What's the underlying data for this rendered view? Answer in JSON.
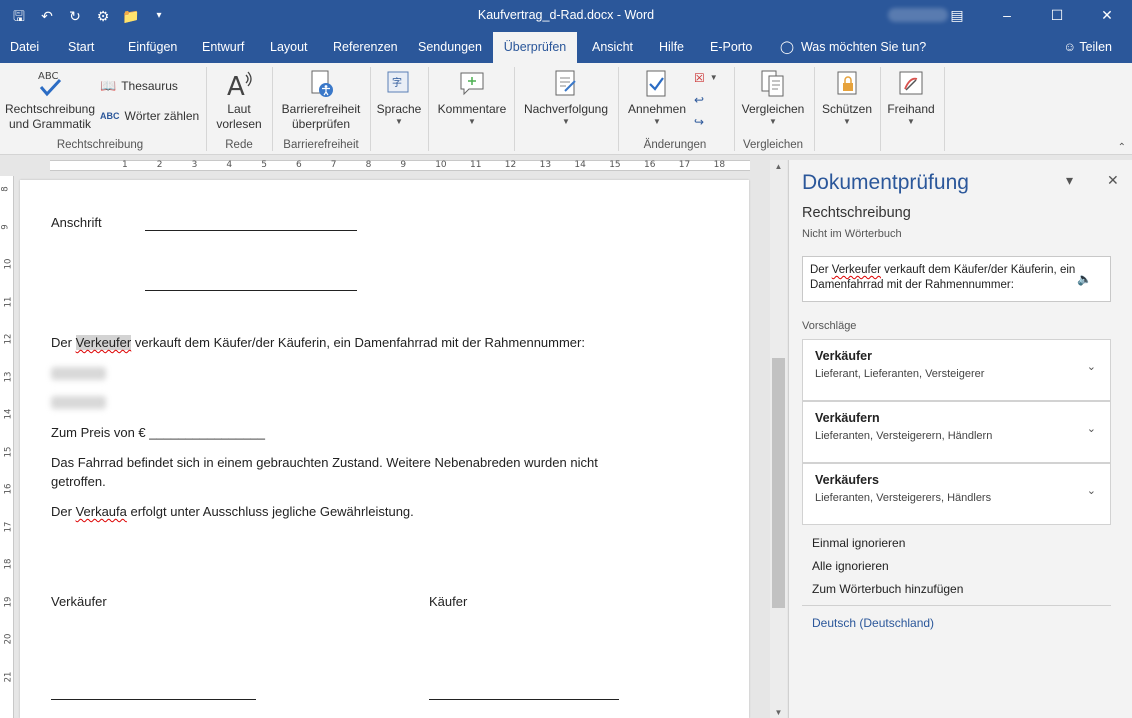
{
  "window": {
    "title": "Kaufvertrag_d-Rad.docx  -  Word",
    "qat_icons": [
      "save-icon",
      "undo-icon",
      "redo-icon",
      "sync-icon",
      "folder-icon",
      "customize-icon"
    ]
  },
  "tabs": [
    {
      "label": "Datei"
    },
    {
      "label": "Start"
    },
    {
      "label": "Einfügen"
    },
    {
      "label": "Entwurf"
    },
    {
      "label": "Layout"
    },
    {
      "label": "Referenzen"
    },
    {
      "label": "Sendungen"
    },
    {
      "label": "Überprüfen",
      "active": true
    },
    {
      "label": "Ansicht"
    },
    {
      "label": "Hilfe"
    },
    {
      "label": "E-Porto"
    }
  ],
  "tell_me": "Was möchten Sie tun?",
  "share": "Teilen",
  "ribbon": {
    "spelling": "Rechtschreibung und Grammatik",
    "spelling_l1": "Rechtschreibung",
    "spelling_l2": "und Grammatik",
    "thesaurus": "Thesaurus",
    "wordcount": "Wörter zählen",
    "group_spelling": "Rechtschreibung",
    "readaloud_l1": "Laut",
    "readaloud_l2": "vorlesen",
    "group_speech": "Rede",
    "access_l1": "Barrierefreiheit",
    "access_l2": "überprüfen",
    "group_access": "Barrierefreiheit",
    "language": "Sprache",
    "comments": "Kommentare",
    "tracking": "Nachverfolgung",
    "accept": "Annehmen",
    "group_changes": "Änderungen",
    "compare": "Vergleichen",
    "group_compare": "Vergleichen",
    "protect": "Schützen",
    "ink": "Freihand"
  },
  "ruler": {
    "h_numbers": [
      "1",
      "2",
      "3",
      "4",
      "5",
      "6",
      "7",
      "8",
      "9",
      "10",
      "11",
      "12",
      "13",
      "14",
      "15",
      "16",
      "17",
      "18"
    ],
    "v_numbers": [
      "8",
      "9",
      "10",
      "11",
      "12",
      "13",
      "14",
      "15",
      "16",
      "17",
      "18",
      "19",
      "20",
      "21"
    ]
  },
  "document": {
    "address_label": "Anschrift",
    "sentence_pre": "Der ",
    "sentence_word": "Verkeufer",
    "sentence_post": " verkauft dem Käufer/der Käuferin, ein Damenfahrrad mit der Rahmennummer:",
    "price": "Zum Preis von € ________________",
    "condition_l1": "Das Fahrrad befindet sich in einem gebrauchten Zustand. Weitere Nebenabreden wurden nicht",
    "condition_l2": "getroffen.",
    "warranty_pre": "Der ",
    "warranty_word": "Verkaufa",
    "warranty_post": " erfolgt unter Ausschluss jegliche Gewährleistung.",
    "seller": "Verkäufer",
    "buyer": "Käufer"
  },
  "pane": {
    "title": "Dokumentprüfung",
    "section": "Rechtschreibung",
    "subsection": "Nicht im Wörterbuch",
    "context_pre": "Der ",
    "context_word": "Verkeufer",
    "context_post": " verkauft dem Käufer/der Käuferin, ein Damenfahrrad mit der Rahmennummer:",
    "suggestions_label": "Vorschläge",
    "suggestions": [
      {
        "word": "Verkäufer",
        "synonyms": "Lieferant, Lieferanten, Versteigerer"
      },
      {
        "word": "Verkäufern",
        "synonyms": "Lieferanten, Versteigerern, Händlern"
      },
      {
        "word": "Verkäufers",
        "synonyms": "Lieferanten, Versteigerers, Händlers"
      }
    ],
    "ignore_once": "Einmal ignorieren",
    "ignore_all": "Alle ignorieren",
    "add_dictionary": "Zum Wörterbuch hinzufügen",
    "language": "Deutsch (Deutschland)"
  }
}
